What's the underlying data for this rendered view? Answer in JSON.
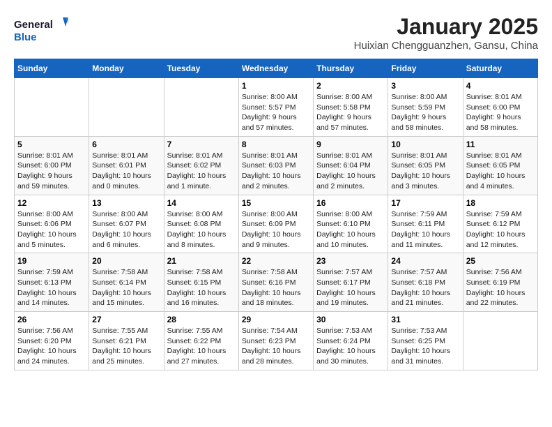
{
  "header": {
    "logo_line1": "General",
    "logo_line2": "Blue",
    "month_title": "January 2025",
    "location": "Huixian Chengguanzhen, Gansu, China"
  },
  "weekdays": [
    "Sunday",
    "Monday",
    "Tuesday",
    "Wednesday",
    "Thursday",
    "Friday",
    "Saturday"
  ],
  "weeks": [
    [
      {
        "day": "",
        "info": ""
      },
      {
        "day": "",
        "info": ""
      },
      {
        "day": "",
        "info": ""
      },
      {
        "day": "1",
        "info": "Sunrise: 8:00 AM\nSunset: 5:57 PM\nDaylight: 9 hours and 57 minutes."
      },
      {
        "day": "2",
        "info": "Sunrise: 8:00 AM\nSunset: 5:58 PM\nDaylight: 9 hours and 57 minutes."
      },
      {
        "day": "3",
        "info": "Sunrise: 8:00 AM\nSunset: 5:59 PM\nDaylight: 9 hours and 58 minutes."
      },
      {
        "day": "4",
        "info": "Sunrise: 8:01 AM\nSunset: 6:00 PM\nDaylight: 9 hours and 58 minutes."
      }
    ],
    [
      {
        "day": "5",
        "info": "Sunrise: 8:01 AM\nSunset: 6:00 PM\nDaylight: 9 hours and 59 minutes."
      },
      {
        "day": "6",
        "info": "Sunrise: 8:01 AM\nSunset: 6:01 PM\nDaylight: 10 hours and 0 minutes."
      },
      {
        "day": "7",
        "info": "Sunrise: 8:01 AM\nSunset: 6:02 PM\nDaylight: 10 hours and 1 minute."
      },
      {
        "day": "8",
        "info": "Sunrise: 8:01 AM\nSunset: 6:03 PM\nDaylight: 10 hours and 2 minutes."
      },
      {
        "day": "9",
        "info": "Sunrise: 8:01 AM\nSunset: 6:04 PM\nDaylight: 10 hours and 2 minutes."
      },
      {
        "day": "10",
        "info": "Sunrise: 8:01 AM\nSunset: 6:05 PM\nDaylight: 10 hours and 3 minutes."
      },
      {
        "day": "11",
        "info": "Sunrise: 8:01 AM\nSunset: 6:05 PM\nDaylight: 10 hours and 4 minutes."
      }
    ],
    [
      {
        "day": "12",
        "info": "Sunrise: 8:00 AM\nSunset: 6:06 PM\nDaylight: 10 hours and 5 minutes."
      },
      {
        "day": "13",
        "info": "Sunrise: 8:00 AM\nSunset: 6:07 PM\nDaylight: 10 hours and 6 minutes."
      },
      {
        "day": "14",
        "info": "Sunrise: 8:00 AM\nSunset: 6:08 PM\nDaylight: 10 hours and 8 minutes."
      },
      {
        "day": "15",
        "info": "Sunrise: 8:00 AM\nSunset: 6:09 PM\nDaylight: 10 hours and 9 minutes."
      },
      {
        "day": "16",
        "info": "Sunrise: 8:00 AM\nSunset: 6:10 PM\nDaylight: 10 hours and 10 minutes."
      },
      {
        "day": "17",
        "info": "Sunrise: 7:59 AM\nSunset: 6:11 PM\nDaylight: 10 hours and 11 minutes."
      },
      {
        "day": "18",
        "info": "Sunrise: 7:59 AM\nSunset: 6:12 PM\nDaylight: 10 hours and 12 minutes."
      }
    ],
    [
      {
        "day": "19",
        "info": "Sunrise: 7:59 AM\nSunset: 6:13 PM\nDaylight: 10 hours and 14 minutes."
      },
      {
        "day": "20",
        "info": "Sunrise: 7:58 AM\nSunset: 6:14 PM\nDaylight: 10 hours and 15 minutes."
      },
      {
        "day": "21",
        "info": "Sunrise: 7:58 AM\nSunset: 6:15 PM\nDaylight: 10 hours and 16 minutes."
      },
      {
        "day": "22",
        "info": "Sunrise: 7:58 AM\nSunset: 6:16 PM\nDaylight: 10 hours and 18 minutes."
      },
      {
        "day": "23",
        "info": "Sunrise: 7:57 AM\nSunset: 6:17 PM\nDaylight: 10 hours and 19 minutes."
      },
      {
        "day": "24",
        "info": "Sunrise: 7:57 AM\nSunset: 6:18 PM\nDaylight: 10 hours and 21 minutes."
      },
      {
        "day": "25",
        "info": "Sunrise: 7:56 AM\nSunset: 6:19 PM\nDaylight: 10 hours and 22 minutes."
      }
    ],
    [
      {
        "day": "26",
        "info": "Sunrise: 7:56 AM\nSunset: 6:20 PM\nDaylight: 10 hours and 24 minutes."
      },
      {
        "day": "27",
        "info": "Sunrise: 7:55 AM\nSunset: 6:21 PM\nDaylight: 10 hours and 25 minutes."
      },
      {
        "day": "28",
        "info": "Sunrise: 7:55 AM\nSunset: 6:22 PM\nDaylight: 10 hours and 27 minutes."
      },
      {
        "day": "29",
        "info": "Sunrise: 7:54 AM\nSunset: 6:23 PM\nDaylight: 10 hours and 28 minutes."
      },
      {
        "day": "30",
        "info": "Sunrise: 7:53 AM\nSunset: 6:24 PM\nDaylight: 10 hours and 30 minutes."
      },
      {
        "day": "31",
        "info": "Sunrise: 7:53 AM\nSunset: 6:25 PM\nDaylight: 10 hours and 31 minutes."
      },
      {
        "day": "",
        "info": ""
      }
    ]
  ]
}
